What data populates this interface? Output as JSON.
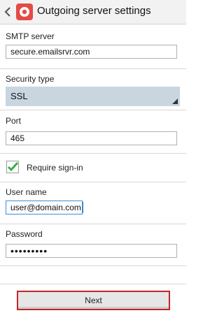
{
  "header": {
    "title": "Outgoing server settings"
  },
  "smtp": {
    "label": "SMTP server",
    "value": "secure.emailsrvr.com"
  },
  "security": {
    "label": "Security type",
    "value": "SSL"
  },
  "port": {
    "label": "Port",
    "value": "465"
  },
  "signin": {
    "label": "Require sign-in",
    "checked": true
  },
  "username": {
    "label": "User name",
    "value": "user@domain.com"
  },
  "password": {
    "label": "Password",
    "value": "•••••••••"
  },
  "footer": {
    "next_label": "Next"
  },
  "colors": {
    "accent": "#e34c44",
    "select_bg": "#c9d6e0",
    "check": "#2fb24a",
    "button_border": "#c0262b"
  }
}
